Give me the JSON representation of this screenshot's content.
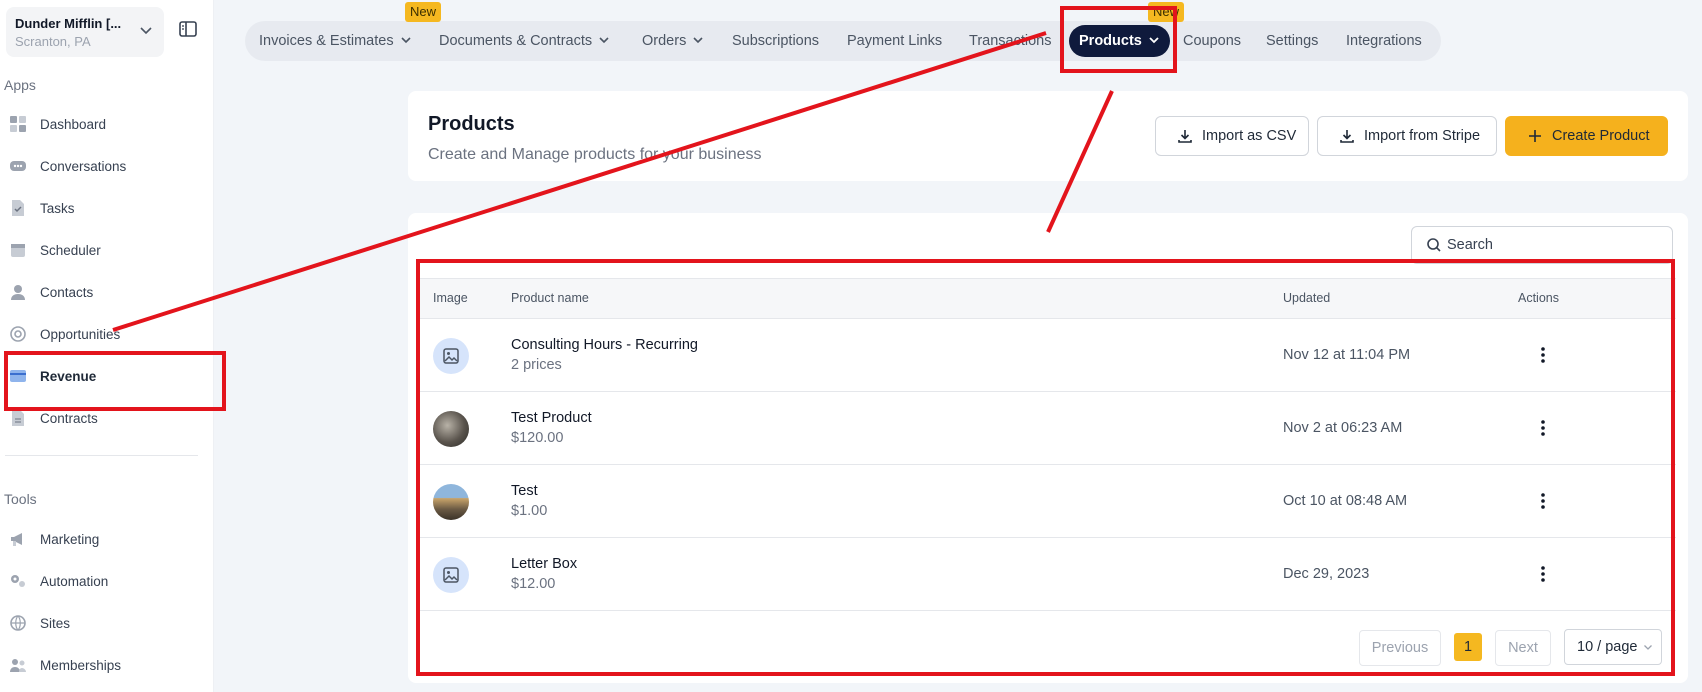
{
  "account": {
    "name": "Dunder Mifflin [...",
    "location": "Scranton, PA"
  },
  "sidebar": {
    "apps_label": "Apps",
    "tools_label": "Tools",
    "items": [
      {
        "label": "Dashboard",
        "icon": "dashboard-icon"
      },
      {
        "label": "Conversations",
        "icon": "chat-icon"
      },
      {
        "label": "Tasks",
        "icon": "tasks-icon"
      },
      {
        "label": "Scheduler",
        "icon": "calendar-icon"
      },
      {
        "label": "Contacts",
        "icon": "user-icon"
      },
      {
        "label": "Opportunities",
        "icon": "target-icon"
      },
      {
        "label": "Revenue",
        "icon": "card-icon",
        "active": true
      },
      {
        "label": "Contracts",
        "icon": "document-icon"
      }
    ],
    "tools": [
      {
        "label": "Marketing",
        "icon": "megaphone-icon"
      },
      {
        "label": "Automation",
        "icon": "gears-icon"
      },
      {
        "label": "Sites",
        "icon": "sites-icon"
      },
      {
        "label": "Memberships",
        "icon": "members-icon"
      }
    ]
  },
  "topnav": {
    "tabs": [
      {
        "label": "Invoices & Estimates",
        "dropdown": true
      },
      {
        "label": "Documents & Contracts",
        "dropdown": true
      },
      {
        "label": "Orders",
        "dropdown": true
      },
      {
        "label": "Subscriptions"
      },
      {
        "label": "Payment Links"
      },
      {
        "label": "Transactions"
      },
      {
        "label": "Products",
        "dropdown": true,
        "active": true
      },
      {
        "label": "Coupons"
      },
      {
        "label": "Settings"
      },
      {
        "label": "Integrations"
      }
    ],
    "badge_new_1": "New",
    "badge_new_2": "New"
  },
  "header": {
    "title": "Products",
    "subtitle": "Create and Manage products for your business",
    "import_csv_label": "Import as CSV",
    "import_stripe_label": "Import from Stripe",
    "create_label": "Create Product"
  },
  "table": {
    "search_placeholder": "Search",
    "columns": {
      "image": "Image",
      "name": "Product name",
      "updated": "Updated",
      "actions": "Actions"
    },
    "rows": [
      {
        "name": "Consulting Hours - Recurring",
        "sub": "2 prices",
        "updated": "Nov 12 at 11:04 PM",
        "image": "placeholder"
      },
      {
        "name": "Test Product",
        "sub": "$120.00",
        "updated": "Nov 2 at 06:23 AM",
        "image": "photo"
      },
      {
        "name": "Test",
        "sub": "$1.00",
        "updated": "Oct 10 at 08:48 AM",
        "image": "photo"
      },
      {
        "name": "Letter Box",
        "sub": "$12.00",
        "updated": "Dec 29, 2023",
        "image": "placeholder"
      }
    ]
  },
  "pagination": {
    "previous": "Previous",
    "page": "1",
    "next": "Next",
    "per_page": "10 / page"
  },
  "colors": {
    "accent": "#f5b11d",
    "nav_active": "#0f1a3c",
    "annotation": "#e3141c"
  }
}
